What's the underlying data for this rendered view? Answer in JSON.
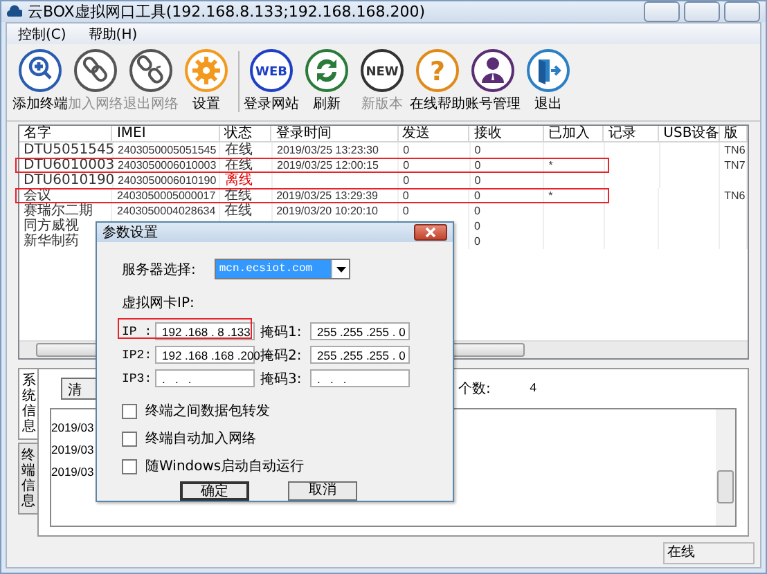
{
  "window": {
    "title": "云BOX虚拟网口工具(192.168.8.133;192.168.168.200)"
  },
  "menu": [
    {
      "label": "控制(C)"
    },
    {
      "label": "帮助(H)"
    }
  ],
  "toolbar_groups": [
    [
      {
        "kind": "add",
        "label": "添加终端",
        "disabled": false
      },
      {
        "kind": "link",
        "label": "加入网络",
        "disabled": true
      },
      {
        "kind": "unlink",
        "label": "退出网络",
        "disabled": true
      },
      {
        "kind": "settings",
        "label": "设置",
        "disabled": false
      }
    ],
    [
      {
        "kind": "web",
        "glyph": "WEB",
        "label": "登录网站",
        "disabled": false
      },
      {
        "kind": "refresh",
        "label": "刷新",
        "disabled": false
      },
      {
        "kind": "new",
        "glyph": "NEW",
        "label": "新版本",
        "disabled": true
      },
      {
        "kind": "help",
        "glyph": "?",
        "label": "在线帮助",
        "disabled": false
      },
      {
        "kind": "account",
        "label": "账号管理",
        "disabled": false
      },
      {
        "kind": "exit",
        "label": "退出",
        "disabled": false
      }
    ]
  ],
  "table": {
    "columns": [
      "名字",
      "IMEI",
      "状态",
      "登录时间",
      "发送",
      "接收",
      "已加入",
      "记录",
      "USB设备",
      "版"
    ],
    "rows": [
      {
        "name": "DTU5051545",
        "imei": "2403050005051545",
        "status": "在线",
        "online": true,
        "login_time": "2019/03/25 13:23:30",
        "sent": "0",
        "received": "0",
        "version": "TN6",
        "highlighted": false
      },
      {
        "name": "DTU6010003",
        "imei": "2403050006010003",
        "status": "在线",
        "online": true,
        "login_time": "2019/03/25 12:00:15",
        "sent": "0",
        "received": "0",
        "joined": "*",
        "version": "TN7",
        "highlighted": true
      },
      {
        "name": "DTU6010190",
        "imei": "2403050006010190",
        "status": "离线",
        "online": false,
        "sent": "0",
        "received": "0",
        "highlighted": false
      },
      {
        "name": "会议",
        "imei": "2403050005000017",
        "status": "在线",
        "online": true,
        "login_time": "2019/03/25 13:29:39",
        "sent": "0",
        "received": "0",
        "joined": "*",
        "version": "TN6",
        "highlighted": true
      },
      {
        "name": "赛瑞尔二期",
        "imei": "2403050004028634",
        "status": "在线",
        "online": true,
        "login_time": "2019/03/20 10:20:10",
        "sent": "0",
        "received": "0",
        "highlighted": false
      },
      {
        "name": "同方威视",
        "received": "0",
        "highlighted": false
      },
      {
        "name": "新华制药",
        "received": "0",
        "highlighted": false
      }
    ]
  },
  "bottom": {
    "side_tabs": [
      {
        "label": "系统信息",
        "selected": true
      },
      {
        "label": "终端信息",
        "selected": false
      }
    ],
    "clear_button": "清",
    "count_label": "个数:",
    "count": "4",
    "log": [
      "2019/03",
      "2019/03",
      "2019/03"
    ]
  },
  "status_bar": {
    "state": "在线"
  },
  "dialog": {
    "title": "参数设置",
    "server_label": "服务器选择:",
    "server": "mcn.ecsiot.com",
    "section_label": "虚拟网卡IP:",
    "ip_rows": [
      {
        "label": "IP :",
        "ip": "192 .168 . 8 .133",
        "mask_label": "掩码1:",
        "mask": "255 .255 .255 . 0",
        "highlighted": true
      },
      {
        "label": "IP2:",
        "ip": "192 .168 .168 .200",
        "mask_label": "掩码2:",
        "mask": "255 .255 .255 . 0",
        "highlighted": false
      },
      {
        "label": "IP3:",
        "ip": ".   .   .",
        "mask_label": "掩码3:",
        "mask": ".   .   .",
        "highlighted": false
      }
    ],
    "options": [
      {
        "label": "终端之间数据包转发",
        "checked": false
      },
      {
        "label": "终端自动加入网络",
        "checked": false
      },
      {
        "label": "随Windows启动自动运行",
        "checked": false
      }
    ],
    "buttons": [
      {
        "label": "确定",
        "default": true
      },
      {
        "label": "取消",
        "default": false
      }
    ]
  }
}
